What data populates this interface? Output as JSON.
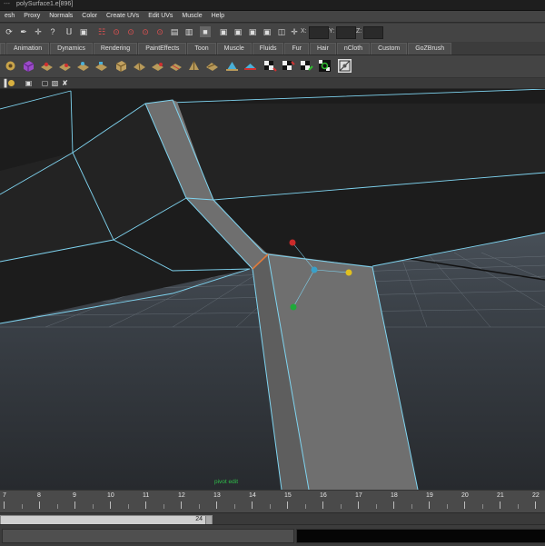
{
  "window": {
    "title": "polySurface1.e[896]",
    "dash": "---"
  },
  "menus": [
    "esh",
    "Proxy",
    "Normals",
    "Color",
    "Create UVs",
    "Edit UVs",
    "Muscle",
    "Help"
  ],
  "statusline": {
    "x_label": "X:",
    "y_label": "Y:",
    "z_label": "Z:",
    "x_value": "",
    "y_value": "",
    "z_value": ""
  },
  "shelf_tabs": [
    "",
    "Animation",
    "Dynamics",
    "Rendering",
    "PaintEffects",
    "Toon",
    "Muscle",
    "Fluids",
    "Fur",
    "Hair",
    "nCloth",
    "Custom",
    "GoZBrush"
  ],
  "viewport": {
    "manip_label": "pivot edit"
  },
  "timeline": {
    "ticks": [
      "7",
      "8",
      "9",
      "10",
      "11",
      "12",
      "13",
      "14",
      "15",
      "16",
      "17",
      "18",
      "19",
      "20",
      "21",
      "22"
    ],
    "current_frame": "24"
  },
  "colors": {
    "ui_bg": "#444444",
    "viewport_bg": "#2d3034",
    "wire": "#7fd4f0",
    "mesh_face": "#707070",
    "mesh_dark": "#1c1c1c",
    "axis_x": "#c92a2a",
    "axis_y": "#1faa3a",
    "axis_z": "#e0c020",
    "pivot": "#3aa0c8"
  }
}
